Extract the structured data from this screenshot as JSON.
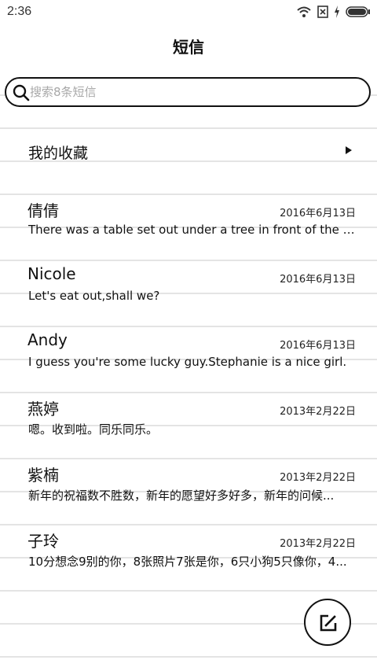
{
  "status_bar": {
    "time": "2:36",
    "icons": [
      "wifi-icon",
      "sim-blocked-icon",
      "charging-icon",
      "battery-icon"
    ]
  },
  "header": {
    "title": "短信"
  },
  "search": {
    "placeholder": "搜索8条短信",
    "value": ""
  },
  "favorites": {
    "label": "我的收藏",
    "icon": "arrow-right-icon"
  },
  "messages": [
    {
      "name": "倩倩",
      "date": "2016年6月13日",
      "preview": "There was a table set out under a tree in front of the house..."
    },
    {
      "name": "Nicole",
      "date": "2016年6月13日",
      "preview": "Let's eat out,shall we?"
    },
    {
      "name": "Andy",
      "date": "2016年6月13日",
      "preview": "I guess you're some lucky guy.Stephanie is a nice girl."
    },
    {
      "name": "燕婷",
      "date": "2013年2月22日",
      "preview": "嗯。收到啦。同乐同乐。"
    },
    {
      "name": "紫楠",
      "date": "2013年2月22日",
      "preview": "新年的祝福数不胜数，新年的愿望好多好多，新年的问候..."
    },
    {
      "name": "子玲",
      "date": "2013年2月22日",
      "preview": "10分想念9别的你，8张照片7张是你，6只小狗5只像你，4..."
    }
  ],
  "compose": {
    "icon": "compose-icon"
  },
  "colors": {
    "background": "#ffffff",
    "ruled_line": "#e4e4e4",
    "text": "#111111",
    "placeholder": "#a8a8a8"
  }
}
